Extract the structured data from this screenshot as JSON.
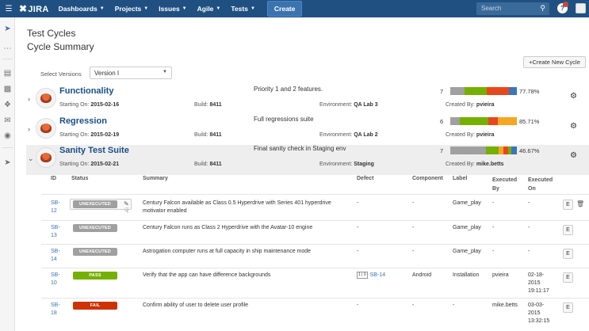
{
  "nav": {
    "logo": "JIRA",
    "items": [
      "Dashboards",
      "Projects",
      "Issues",
      "Agile",
      "Tests"
    ],
    "create": "Create",
    "search_placeholder": "Search",
    "help": "?"
  },
  "page": {
    "title": "Test Cycles",
    "subtitle": "Cycle Summary",
    "create_cycle_label": "+Create New Cycle",
    "select_label": "Select Versions",
    "select_value": "Version I"
  },
  "cycles": [
    {
      "name": "Functionality",
      "starting_label": "Starting On:",
      "starting": "2015-02-16",
      "build_label": "Build:",
      "build": "8411",
      "summary": "Priority 1 and 2 features.",
      "env_label": "Environment:",
      "env": "QA Lab 3",
      "count": "7",
      "percent": "77.78%",
      "created_label": "Created By:",
      "created_by": "pvieira",
      "segments": [
        {
          "color": "#a0a0a0",
          "share": 0.22
        },
        {
          "color": "#75b000",
          "share": 0.33
        },
        {
          "color": "#e8471c",
          "share": 0.33
        },
        {
          "color": "#3a76b8",
          "share": 0.12
        }
      ]
    },
    {
      "name": "Regression",
      "starting_label": "Starting On:",
      "starting": "2015-02-19",
      "build_label": "Build:",
      "build": "8411",
      "summary": "Full regressions suite",
      "env_label": "Environment:",
      "env": "QA Lab 2",
      "count": "6",
      "percent": "85.71%",
      "created_label": "Created By:",
      "created_by": "pvieira",
      "segments": [
        {
          "color": "#a0a0a0",
          "share": 0.14
        },
        {
          "color": "#75b000",
          "share": 0.43
        },
        {
          "color": "#e8471c",
          "share": 0.14
        },
        {
          "color": "#f5a623",
          "share": 0.29
        }
      ]
    },
    {
      "name": "Sanity Test Suite",
      "starting_label": "Starting On:",
      "starting": "2015-02-21",
      "build_label": "Build:",
      "build": "8411",
      "summary": "Final sanity check in Staging env",
      "env_label": "Environment:",
      "env": "Staging",
      "count": "7",
      "percent": "46.67%",
      "created_label": "Created By:",
      "created_by": "mike.betts",
      "segments": [
        {
          "color": "#a0a0a0",
          "share": 0.53
        },
        {
          "color": "#75b000",
          "share": 0.2
        },
        {
          "color": "#f5a623",
          "share": 0.07
        },
        {
          "color": "#e8471c",
          "share": 0.07
        },
        {
          "color": "#75b000",
          "share": 0.05
        },
        {
          "color": "#3a76b8",
          "share": 0.08
        }
      ]
    }
  ],
  "exec_table": {
    "headers": {
      "id": "ID",
      "status": "Status",
      "summary": "Summary",
      "defect": "Defect",
      "component": "Component",
      "label": "Label",
      "executed_by_1": "Executed",
      "executed_by_2": "By",
      "executed_on_1": "Executed",
      "executed_on_2": "On"
    },
    "rows": [
      {
        "id1": "SB-",
        "id2": "12",
        "status": "UNEXECUTED",
        "status_kind": "unexecuted",
        "summary1": "Century Falcon available as Class 0.5 Hyperdrive with Series 401 hyperdrive",
        "summary2": "motivator enabled",
        "defect_count": "",
        "defect": "-",
        "component": "-",
        "label": "Game_play",
        "executed_by": "-",
        "executed_on1": "-",
        "executed_on2": "",
        "e": "E"
      },
      {
        "id1": "SB-",
        "id2": "13",
        "status": "UNEXECUTED",
        "status_kind": "unexecuted",
        "summary1": "Century Falcon runs as Class 2 Hyperdrive with the Avatar-10 engine",
        "summary2": "",
        "defect_count": "",
        "defect": "-",
        "component": "-",
        "label": "Game_play",
        "executed_by": "-",
        "executed_on1": "-",
        "executed_on2": "",
        "e": "E"
      },
      {
        "id1": "SB-",
        "id2": "14",
        "status": "UNEXECUTED",
        "status_kind": "unexecuted",
        "summary1": "Astrogation computer runs at full capacity in ship maintenance mode",
        "summary2": "",
        "defect_count": "",
        "defect": "-",
        "component": "-",
        "label": "Game_play",
        "executed_by": "-",
        "executed_on1": "-",
        "executed_on2": "",
        "e": "E"
      },
      {
        "id1": "SB-",
        "id2": "10",
        "status": "PASS",
        "status_kind": "pass",
        "summary1": "Verify that the app can have difference backgrounds",
        "summary2": "",
        "defect_count": "1 | 0",
        "defect": "SB-14",
        "component": "Android",
        "label": "Installation",
        "executed_by": "pvieira",
        "executed_on1": "02-18-",
        "executed_on2": "2015",
        "executed_on3": "19:11:17",
        "e": "E"
      },
      {
        "id1": "SB-",
        "id2": "18",
        "status": "FAIL",
        "status_kind": "fail",
        "summary1": "Confirm ability of user to delete user profile",
        "summary2": "",
        "defect_count": "",
        "defect": "-",
        "component": "-",
        "label": "-",
        "executed_by": "mike.betts",
        "executed_on1": "03-03-",
        "executed_on2": "2015",
        "executed_on3": "13:32:15",
        "e": "E"
      }
    ]
  }
}
